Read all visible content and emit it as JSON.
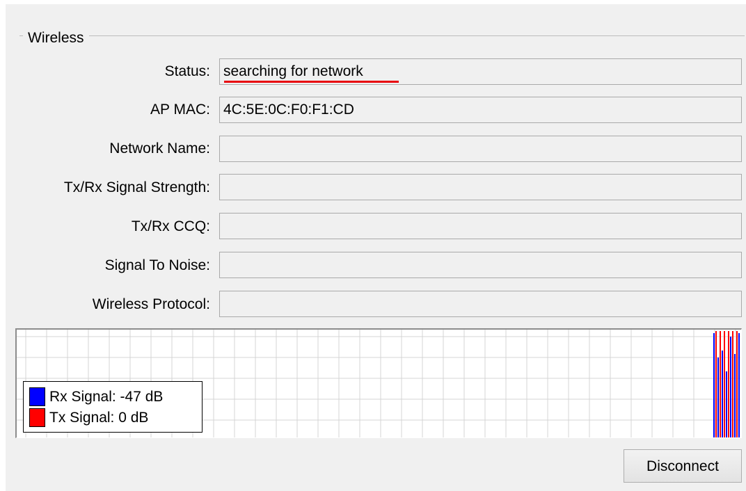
{
  "group": {
    "title": "Wireless"
  },
  "fields": [
    {
      "label": "Status:",
      "value": "searching for network"
    },
    {
      "label": "AP MAC:",
      "value": "4C:5E:0C:F0:F1:CD"
    },
    {
      "label": "Network Name:",
      "value": ""
    },
    {
      "label": "Tx/Rx Signal Strength:",
      "value": ""
    },
    {
      "label": "Tx/Rx CCQ:",
      "value": ""
    },
    {
      "label": "Signal To Noise:",
      "value": ""
    },
    {
      "label": "Wireless Protocol:",
      "value": ""
    }
  ],
  "graph": {
    "legend": [
      {
        "label": "Rx Signal:  -47 dB",
        "color": "#0000ff"
      },
      {
        "label": "Tx Signal:  0 dB",
        "color": "#ff0000"
      }
    ],
    "grid_color": "#d4d4d4"
  },
  "buttons": {
    "disconnect": "Disconnect"
  }
}
